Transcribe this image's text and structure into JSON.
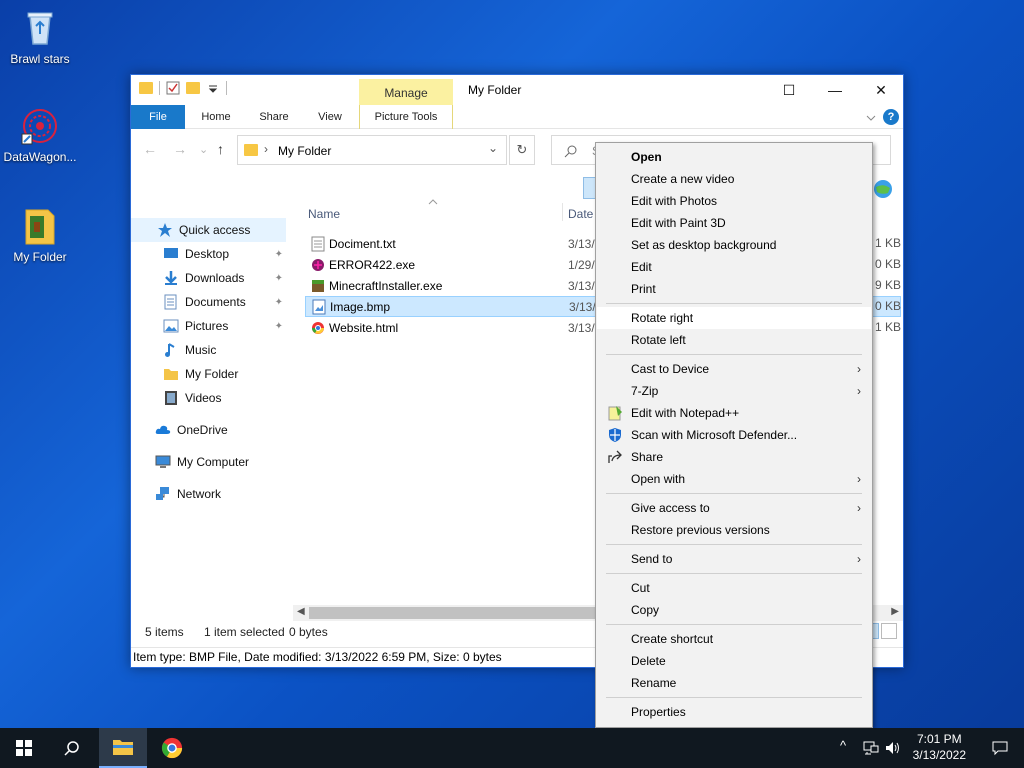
{
  "desktop": {
    "icons": [
      {
        "label": "Brawl stars",
        "icon": "recycle-bin-icon"
      },
      {
        "label": "DataWagon...",
        "icon": "datawagon-icon"
      },
      {
        "label": "My Folder",
        "icon": "folder-icon"
      }
    ]
  },
  "window": {
    "title": "My Folder",
    "manage_tab": "Manage",
    "ribbon_tabs": [
      "File",
      "Home",
      "Share",
      "View",
      "Picture Tools"
    ],
    "controls": {
      "minimize": "—",
      "maximize": "☐",
      "close": "✕"
    },
    "help": "?"
  },
  "navigation": {
    "back": "←",
    "forward": "→",
    "recent": "⌄",
    "up": "↑",
    "address": "My Folder",
    "address_separator": "›",
    "dropdown": "⌄",
    "refresh": "↻",
    "search_placeholder": "S"
  },
  "nav_pane": {
    "items": [
      {
        "label": "Quick access",
        "icon": "star-icon",
        "pinned": false
      },
      {
        "label": "Desktop",
        "icon": "desktop-icon",
        "pinned": true
      },
      {
        "label": "Downloads",
        "icon": "download-icon",
        "pinned": true
      },
      {
        "label": "Documents",
        "icon": "documents-icon",
        "pinned": true
      },
      {
        "label": "Pictures",
        "icon": "pictures-icon",
        "pinned": true
      },
      {
        "label": "Music",
        "icon": "music-icon",
        "pinned": false
      },
      {
        "label": "My Folder",
        "icon": "folder-icon",
        "pinned": false
      },
      {
        "label": "Videos",
        "icon": "videos-icon",
        "pinned": false
      },
      {
        "label": "OneDrive",
        "icon": "cloud-icon",
        "pinned": false
      },
      {
        "label": "My Computer",
        "icon": "computer-icon",
        "pinned": false
      },
      {
        "label": "Network",
        "icon": "network-icon",
        "pinned": false
      }
    ],
    "pin_glyph": "📌"
  },
  "file_list": {
    "columns": {
      "name": "Name",
      "date": "Date"
    },
    "files": [
      {
        "name": "Dociment.txt",
        "date": "3/13/",
        "size": "1 KB",
        "icon": "text-file-icon",
        "selected": false
      },
      {
        "name": "ERROR422.exe",
        "date": "1/29/",
        "size": "0 KB",
        "icon": "exe-icon",
        "selected": false
      },
      {
        "name": "MinecraftInstaller.exe",
        "date": "3/13/",
        "size": "9 KB",
        "icon": "minecraft-icon",
        "selected": false
      },
      {
        "name": "Image.bmp",
        "date": "3/13/",
        "size": "0 KB",
        "icon": "image-file-icon",
        "selected": true
      },
      {
        "name": "Website.html",
        "date": "3/13/",
        "size": "1 KB",
        "icon": "chrome-html-icon",
        "selected": false
      }
    ]
  },
  "status_bar": {
    "count": "5 items",
    "selected": "1 item selected",
    "bytes": "0 bytes"
  },
  "details_bar": "Item type: BMP File, Date modified: 3/13/2022 6:59 PM, Size: 0 bytes",
  "context_menu": {
    "groups": [
      [
        {
          "label": "Open",
          "bold": true
        },
        {
          "label": "Create a new video"
        },
        {
          "label": "Edit with Photos"
        },
        {
          "label": "Edit with Paint 3D"
        },
        {
          "label": "Set as desktop background"
        },
        {
          "label": "Edit"
        },
        {
          "label": "Print"
        }
      ],
      [
        {
          "label": "Rotate right",
          "highlight": true
        },
        {
          "label": "Rotate left"
        }
      ],
      [
        {
          "label": "Cast to Device",
          "submenu": true
        },
        {
          "label": "7-Zip",
          "submenu": true
        },
        {
          "label": "Edit with Notepad++",
          "icon": "notepadpp-icon"
        },
        {
          "label": "Scan with Microsoft Defender...",
          "icon": "defender-icon"
        },
        {
          "label": "Share",
          "icon": "share-icon"
        },
        {
          "label": "Open with",
          "submenu": true
        }
      ],
      [
        {
          "label": "Give access to",
          "submenu": true
        },
        {
          "label": "Restore previous versions"
        }
      ],
      [
        {
          "label": "Send to",
          "submenu": true
        }
      ],
      [
        {
          "label": "Cut"
        },
        {
          "label": "Copy"
        }
      ],
      [
        {
          "label": "Create shortcut"
        },
        {
          "label": "Delete"
        },
        {
          "label": "Rename"
        }
      ],
      [
        {
          "label": "Properties"
        }
      ]
    ],
    "submenu_glyph": "›"
  },
  "taskbar": {
    "start_icon": "windows-logo-icon",
    "search_icon": "search-icon",
    "apps": [
      "file-explorer-icon",
      "chrome-icon"
    ],
    "tray": {
      "chevron": "^",
      "network": "🖧",
      "volume": "🔊"
    },
    "time": "7:01 PM",
    "date": "3/13/2022",
    "notification_glyph": "🗨"
  },
  "colors": {
    "accent": "#1979ca",
    "manage_tab": "#fbf1a1",
    "selection": "#cce8ff",
    "taskbar": "#101820"
  }
}
